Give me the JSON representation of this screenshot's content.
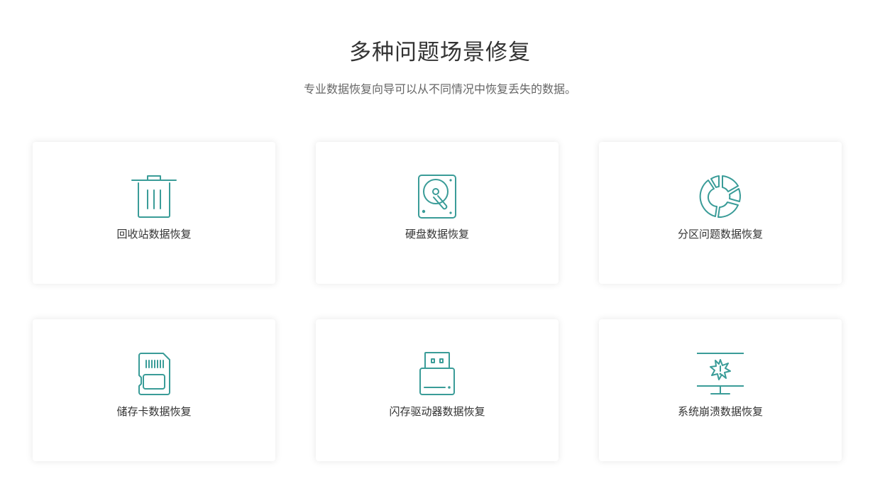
{
  "header": {
    "title": "多种问题场景修复",
    "subtitle": "专业数据恢复向导可以从不同情况中恢复丢失的数据。"
  },
  "accent_color": "#3a9c98",
  "cards": [
    {
      "label": "回收站数据恢复",
      "icon": "recycle-bin-icon"
    },
    {
      "label": "硬盘数据恢复",
      "icon": "hard-drive-icon"
    },
    {
      "label": "分区问题数据恢复",
      "icon": "partition-icon"
    },
    {
      "label": "储存卡数据恢复",
      "icon": "memory-card-icon"
    },
    {
      "label": "闪存驱动器数据恢复",
      "icon": "usb-flash-drive-icon"
    },
    {
      "label": "系统崩溃数据恢复",
      "icon": "system-crash-monitor-icon"
    }
  ]
}
